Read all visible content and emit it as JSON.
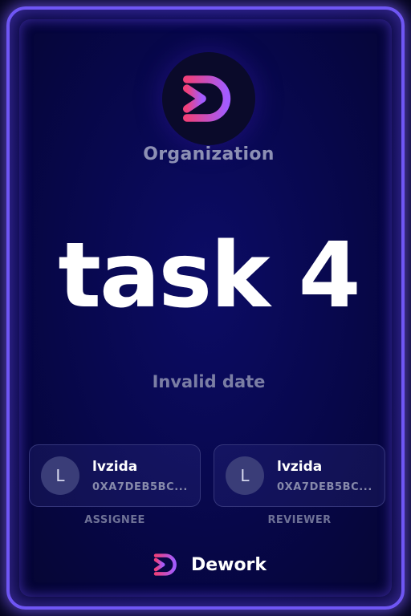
{
  "organization": {
    "name": "Organization",
    "logo_icon": "dework-logo-icon"
  },
  "task": {
    "title": "task 4",
    "date": "Invalid date"
  },
  "assignee": {
    "avatar_initial": "L",
    "name": "lvzida",
    "address": "0XA7DEB5BC...",
    "role": "ASSIGNEE"
  },
  "reviewer": {
    "avatar_initial": "L",
    "name": "lvzida",
    "address": "0XA7DEB5BC...",
    "role": "REVIEWER"
  },
  "brand": {
    "name": "Dework",
    "logo_icon": "dework-logo-icon"
  },
  "colors": {
    "background": "#070749",
    "border_glow": "#6f56f4",
    "logo_gradient_start": "#f0407a",
    "logo_gradient_end": "#a35cff",
    "title": "#ffffff",
    "muted_text": "#8d90b4"
  }
}
